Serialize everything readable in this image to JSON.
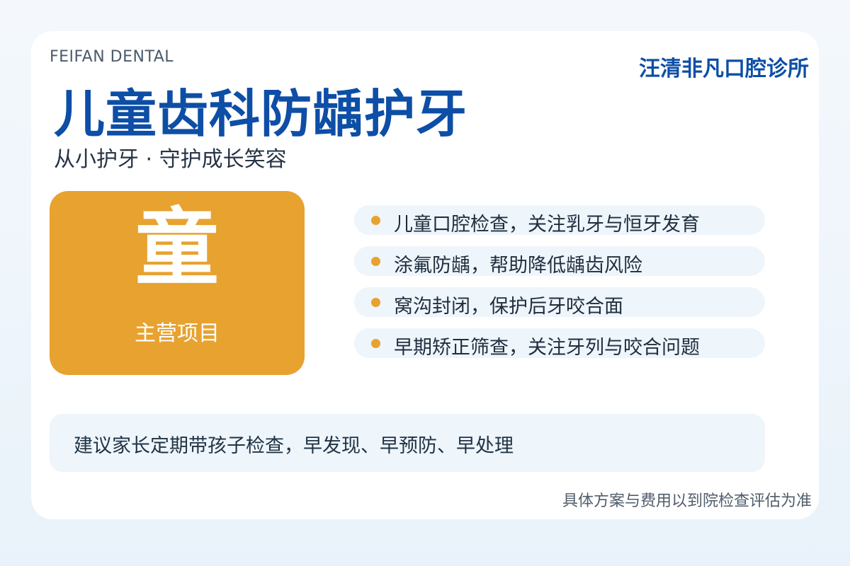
{
  "brand": {
    "english_name": "FEIFAN DENTAL",
    "clinic_name": "汪清非凡口腔诊所"
  },
  "hero": {
    "title": "儿童齿科防龋护牙",
    "subtitle": "从小护牙 · 守护成长笑容"
  },
  "feature": {
    "character": "童",
    "label": "主营项目",
    "color": "#e8a22f"
  },
  "services": [
    {
      "text": "儿童口腔检查，关注乳牙与恒牙发育"
    },
    {
      "text": "涂氟防龋，帮助降低龋齿风险"
    },
    {
      "text": "窝沟封闭，保护后牙咬合面"
    },
    {
      "text": "早期矫正筛查，关注牙列与咬合问题"
    }
  ],
  "advice": "建议家长定期带孩子检查，早发现、早预防、早处理",
  "disclaimer": "具体方案与费用以到院检查评估为准",
  "colors": {
    "primary": "#0d4ea6",
    "accent": "#e8a22f",
    "panel": "#eef5fb"
  }
}
